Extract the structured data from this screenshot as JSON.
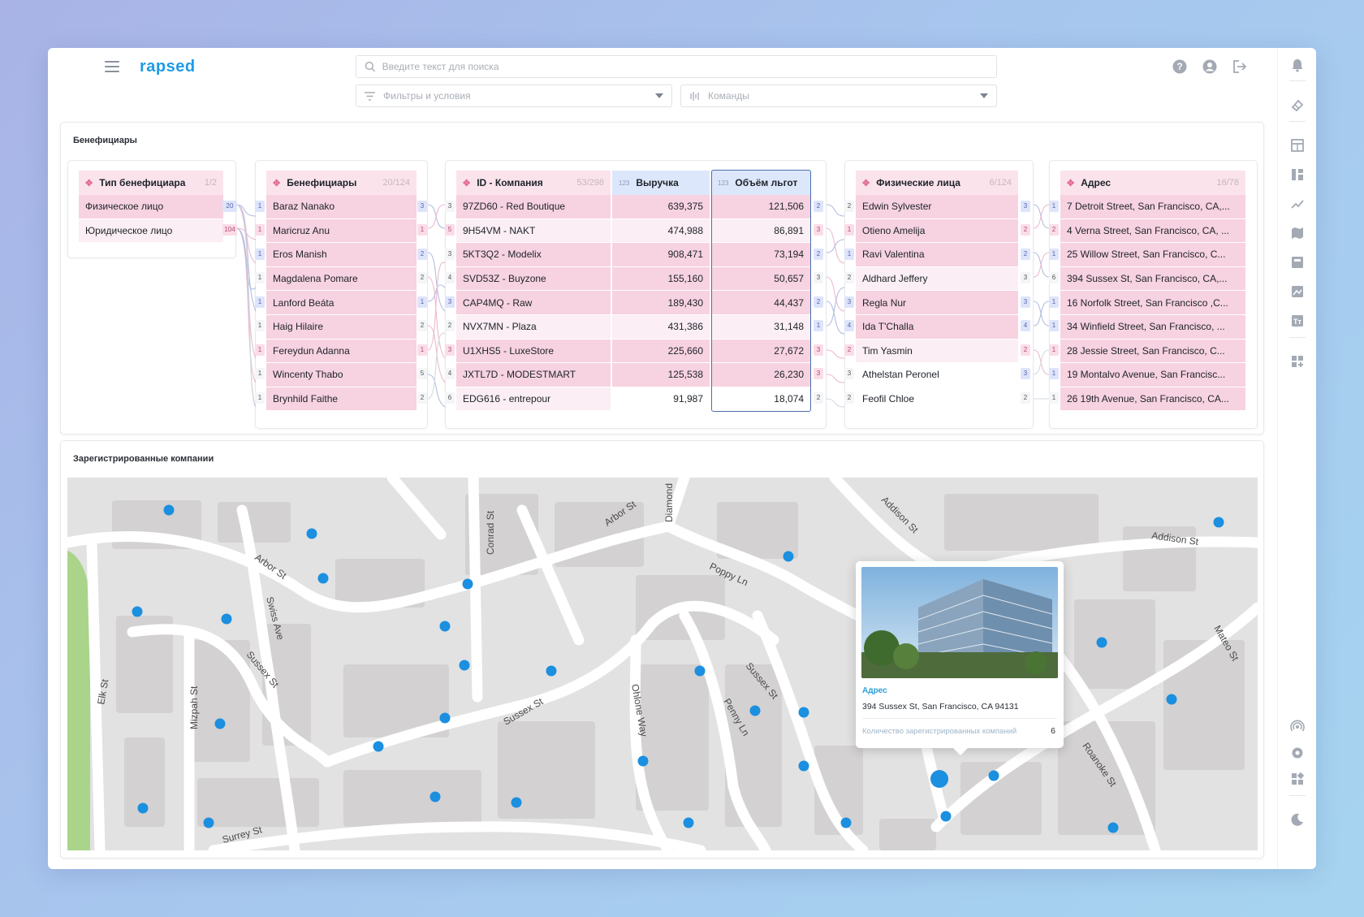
{
  "app": {
    "logo": "rapsed"
  },
  "search": {
    "placeholder": "Введите текст для поиска"
  },
  "filters": {
    "label": "Фильтры и условия"
  },
  "commands": {
    "label": "Команды"
  },
  "panel1": {
    "title": "Бенефициары"
  },
  "panel2": {
    "title": "Зарегистрированные компании"
  },
  "columns": {
    "type": {
      "title": "Тип бенефициара",
      "count": "1/2",
      "rows": [
        "Физическое лицо",
        "Юридическое лицо"
      ],
      "right_badges": [
        "20",
        "104"
      ]
    },
    "beneficiaries": {
      "title": "Бенефициары",
      "count": "20/124",
      "rows": [
        "Baraz Nanako",
        "Maricruz Anu",
        "Eros Manish",
        "Magdalena Pomare",
        "Lanford Beáta",
        "Haig Hilaire",
        "Fereydun Adanna",
        "Wincenty Thabo",
        "Brynhild Faithe"
      ],
      "left_badges": [
        "1",
        "1",
        "1",
        "1",
        "1",
        "1",
        "1",
        "1",
        "1"
      ],
      "right_badges": [
        "3",
        "1",
        "2",
        "2",
        "1",
        "2",
        "1",
        "5",
        "2"
      ]
    },
    "company": {
      "title": "ID - Компания",
      "count": "53/298",
      "rows": [
        "97ZD60 - Red Boutique",
        "9H54VM - NAKT",
        "5KT3Q2 - Modelix",
        "SVD53Z - Buyzone",
        "CAP4MQ - Raw",
        "NVX7MN - Plaza",
        "U1XHS5 - LuxeStore",
        "JXTL7D - MODESTMART",
        "EDG616 - entrepour"
      ],
      "left_badges": [
        "3",
        "5",
        "3",
        "4",
        "3",
        "2",
        "3",
        "4",
        "6"
      ]
    },
    "revenue": {
      "title": "Выручка",
      "type_tag": "123",
      "rows": [
        "639,375",
        "474,988",
        "908,471",
        "155,160",
        "189,430",
        "431,386",
        "225,660",
        "125,538",
        "91,987"
      ]
    },
    "benefits": {
      "title": "Объём льгот",
      "type_tag": "123",
      "rows": [
        "121,506",
        "86,891",
        "73,194",
        "50,657",
        "44,437",
        "31,148",
        "27,672",
        "26,230",
        "18,074"
      ],
      "right_badges": [
        "2",
        "3",
        "2",
        "3",
        "2",
        "1",
        "3",
        "3",
        "2"
      ]
    },
    "persons": {
      "title": "Физические лица",
      "count": "6/124",
      "rows": [
        "Edwin Sylvester",
        "Otieno Amelija",
        "Ravi Valentina",
        "Aldhard Jeffery",
        "Regla Nur",
        "Ida T'Challa",
        "Tim Yasmin",
        "Athelstan Peronel",
        "Feofil Chloe"
      ],
      "left_badges": [
        "2",
        "1",
        "1",
        "2",
        "3",
        "4",
        "2",
        "3",
        "2"
      ],
      "right_badges": [
        "3",
        "2",
        "2",
        "3",
        "3",
        "4",
        "2",
        "3",
        "2"
      ]
    },
    "address": {
      "title": "Адрес",
      "count": "16/78",
      "rows": [
        "7 Detroit Street, San Francisco, CA,...",
        "4 Verna Street, San Francisco, CA, ...",
        "25 Willow Street, San Francisco, C...",
        "394 Sussex St, San Francisco, CA,...",
        "16 Norfolk Street, San Francisco ,C...",
        "34 Winfield Street, San Francisco, ...",
        "28 Jessie Street, San Francisco, C...",
        "19 Montalvo Avenue, San Francisc...",
        "26 19th Avenue, San Francisco, CA..."
      ],
      "left_badges": [
        "1",
        "2",
        "1",
        "6",
        "1",
        "1",
        "1",
        "1",
        "1"
      ]
    }
  },
  "map": {
    "streets": [
      "Arbor St",
      "Arbor St",
      "Conrad St",
      "Diamond",
      "Addison St",
      "Addison St",
      "Poppy Ln",
      "Swiss Ave",
      "Sussex St",
      "Sussex St",
      "Sussex St",
      "Elk St",
      "Mizpah St",
      "Ohlone Way",
      "Penny Ln",
      "Mateo St",
      "Roanoke St",
      "Surrey St"
    ],
    "popup": {
      "address_label": "Адрес",
      "address": "394 Sussex St, San Francisco, CA 94131",
      "count_label": "Количество зарегистрированных компаний",
      "count": "6"
    }
  },
  "colors": {
    "accent": "#1f9be3",
    "pink": "#f7d2e1",
    "selection": "#4c6fae",
    "marker": "#1b8fe0"
  }
}
